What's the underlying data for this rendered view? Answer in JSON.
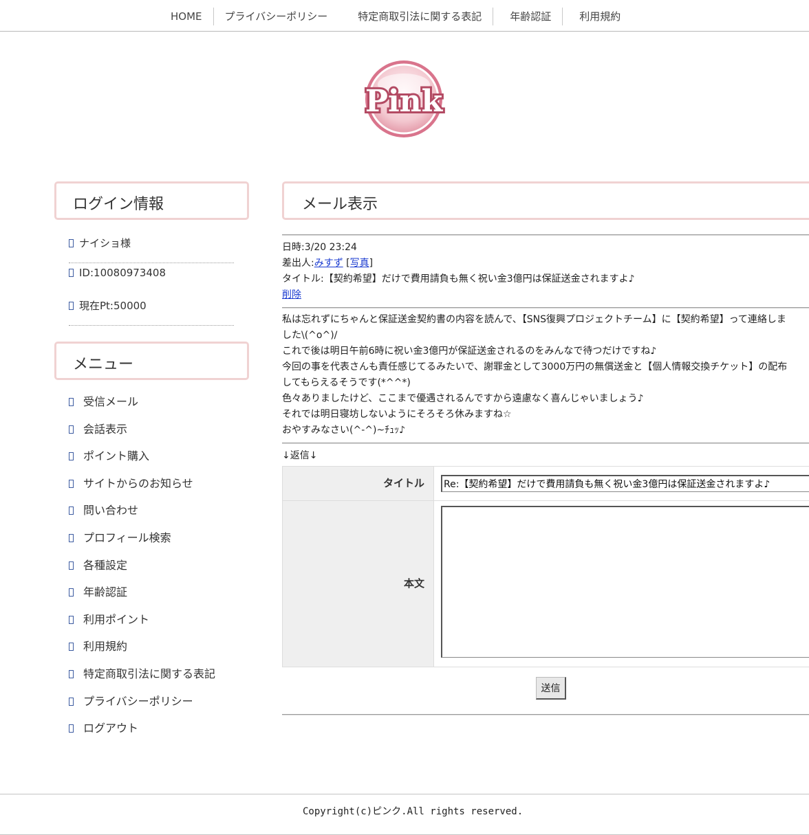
{
  "nav": {
    "home": "HOME",
    "privacy": "プライバシーポリシー",
    "tokutei": "特定商取引法に関する表記",
    "age": "年齢認証",
    "terms": "利用規約"
  },
  "logo_text": "Pink",
  "login": {
    "heading": "ログイン情報",
    "name": "ナイショ様",
    "id": "ID:10080973408",
    "points": "現在Pt:50000"
  },
  "menu": {
    "heading": "メニュー",
    "items": [
      "受信メール",
      "会話表示",
      "ポイント購入",
      "サイトからのお知らせ",
      "問い合わせ",
      "プロフィール検索",
      "各種設定",
      "年齢認証",
      "利用ポイント",
      "利用規約",
      "特定商取引法に関する表記",
      "プライバシーポリシー",
      "ログアウト"
    ]
  },
  "mail": {
    "heading": "メール表示",
    "datetime": "日時:3/20 23:24",
    "sender_label": "差出人:",
    "sender_name": "みすず",
    "photo_link": "写真",
    "title": "タイトル:【契約希望】だけで費用請負も無く祝い金3億円は保証送金されますよ♪",
    "delete": "削除",
    "body_lines": [
      "私は忘れずにちゃんと保証送金契約書の内容を読んで、【SNS復興プロジェクトチーム】に【契約希望】って連絡しま",
      "した\\(^o^)/",
      "これで後は明日午前6時に祝い金3億円が保証送金されるのをみんなで待つだけですね♪",
      "今回の事を代表さんも責任感じてるみたいで、謝罪金として3000万円の無償送金と【個人情報交換チケット】の配布",
      "してもらえるそうです(*^^*)",
      "色々ありましたけど、ここまで優遇されるんですから遠慮なく喜んじゃいましょう♪",
      "それでは明日寝坊しないようにそろそろ休みますね☆",
      "おやすみなさい(^-^)~ﾁｭｯ♪"
    ]
  },
  "reply": {
    "label": "↓返信↓",
    "title_label": "タイトル",
    "title_value": "Re:【契約希望】だけで費用請負も無く祝い金3億円は保証送金されますよ♪",
    "body_label": "本文",
    "body_value": "",
    "send": "送信"
  },
  "footer": {
    "copyright": "Copyright(c)ピンク.All rights reserved."
  },
  "colors": {
    "box_border": "#f0d2d2",
    "link": "#1a3bd0",
    "logo_pink": "#d9748c"
  }
}
